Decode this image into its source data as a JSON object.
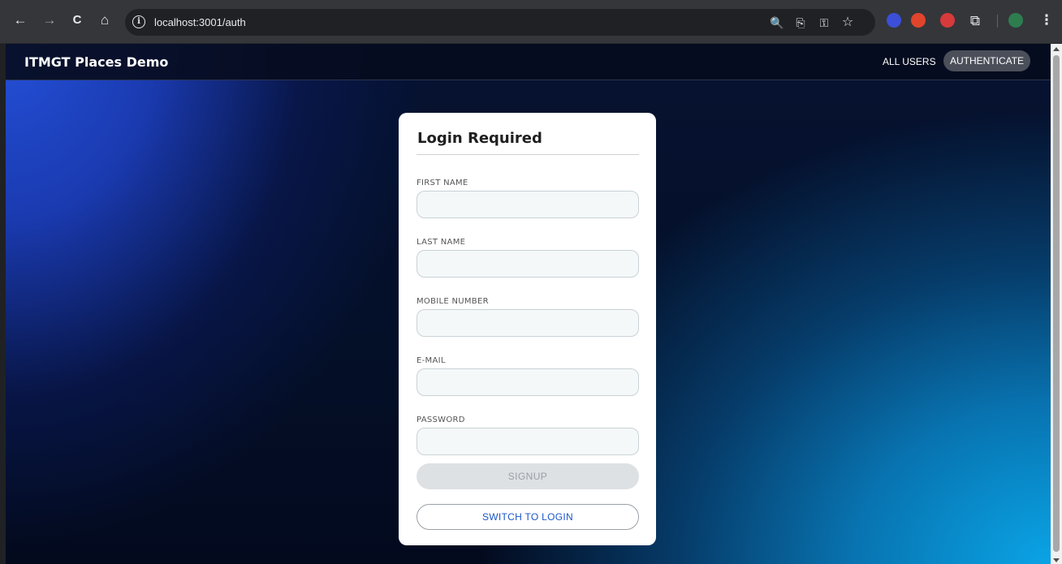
{
  "browser": {
    "url": "localhost:3001/auth",
    "icons": {
      "back": "←",
      "forward": "→",
      "reload": "C",
      "home": "⌂",
      "info": "i",
      "zoom": "🔍",
      "cast": "⎘",
      "password": "⚿",
      "bookmark": "☆",
      "extensions": "⧉",
      "menu": "⋮"
    }
  },
  "header": {
    "title": "ITMGT Places Demo",
    "nav": {
      "all_users": "ALL USERS",
      "authenticate": "AUTHENTICATE"
    }
  },
  "card": {
    "title": "Login Required",
    "fields": {
      "first_name": {
        "label": "FIRST NAME",
        "value": ""
      },
      "last_name": {
        "label": "LAST NAME",
        "value": ""
      },
      "mobile_number": {
        "label": "MOBILE NUMBER",
        "value": ""
      },
      "email": {
        "label": "E-MAIL",
        "value": ""
      },
      "password": {
        "label": "PASSWORD",
        "value": ""
      }
    },
    "signup_label": "SIGNUP",
    "switch_label": "SWITCH TO LOGIN"
  },
  "colors": {
    "link_blue": "#1a56c8",
    "disabled_button": "#dde1e4",
    "header_bg": "#060c1e"
  }
}
